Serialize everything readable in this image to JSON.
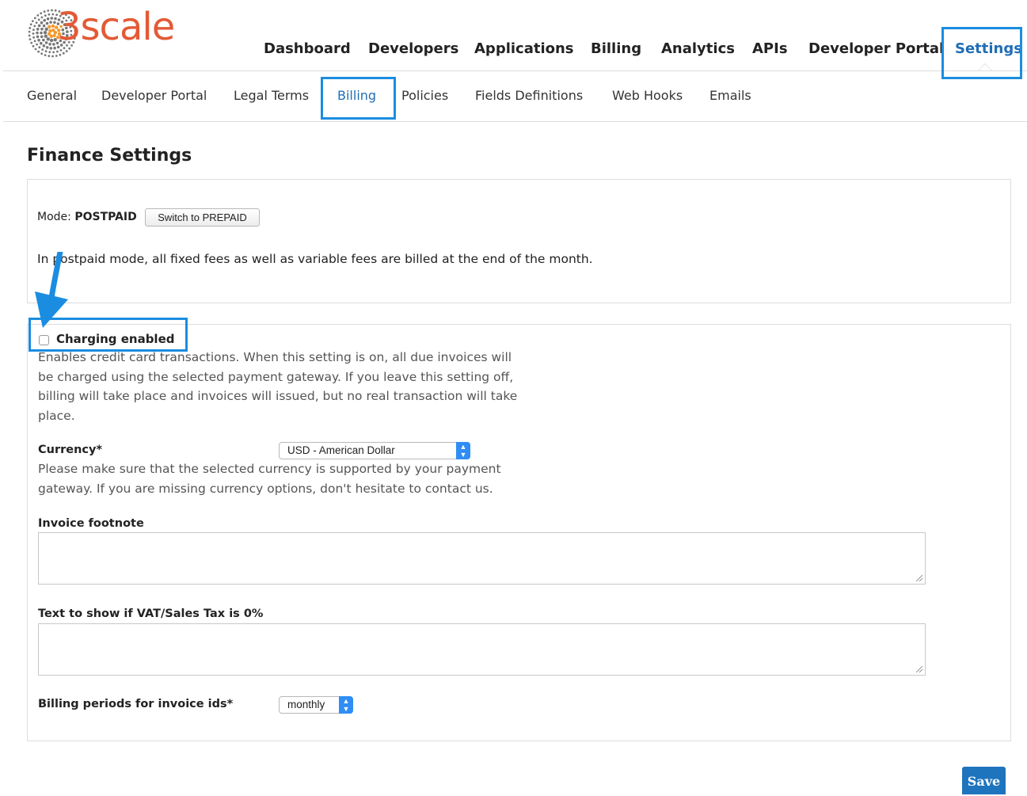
{
  "brand": {
    "name": "3scale",
    "color": "#e35a35"
  },
  "accent_color": "#1b8de0",
  "top_nav": {
    "items": [
      {
        "id": "dashboard",
        "label": "Dashboard"
      },
      {
        "id": "developers",
        "label": "Developers"
      },
      {
        "id": "applications",
        "label": "Applications"
      },
      {
        "id": "billing",
        "label": "Billing"
      },
      {
        "id": "analytics",
        "label": "Analytics"
      },
      {
        "id": "apis",
        "label": "APIs"
      },
      {
        "id": "developer-portal",
        "label": "Developer Portal"
      },
      {
        "id": "settings",
        "label": "Settings"
      }
    ],
    "active": "Settings"
  },
  "sub_nav": {
    "items": [
      {
        "id": "general",
        "label": "General"
      },
      {
        "id": "developer-portal",
        "label": "Developer Portal"
      },
      {
        "id": "legal-terms",
        "label": "Legal Terms"
      },
      {
        "id": "billing",
        "label": "Billing"
      },
      {
        "id": "policies",
        "label": "Policies"
      },
      {
        "id": "fields-definitions",
        "label": "Fields Definitions"
      },
      {
        "id": "web-hooks",
        "label": "Web Hooks"
      },
      {
        "id": "emails",
        "label": "Emails"
      }
    ],
    "active": "Billing"
  },
  "page": {
    "title": "Finance Settings"
  },
  "mode_panel": {
    "mode_label": "Mode:",
    "mode_value": "POSTPAID",
    "switch_button": "Switch to PREPAID",
    "description": "In postpaid mode, all fixed fees as well as variable fees are billed at the end of the month."
  },
  "form": {
    "charging": {
      "label": "Charging enabled",
      "checked": false,
      "help": "Enables credit card transactions. When this setting is on, all due invoices will be charged using the selected payment gateway. If you leave this setting off, billing will take place and invoices will issued, but no real transaction will take place."
    },
    "currency": {
      "label": "Currency*",
      "value": "USD - American Dollar",
      "help": "Please make sure that the selected currency is supported by your payment gateway. If you are missing currency options, don't hesitate to contact us."
    },
    "invoice_footnote": {
      "label": "Invoice footnote",
      "value": ""
    },
    "vat_text": {
      "label": "Text to show if VAT/Sales Tax is 0%",
      "value": ""
    },
    "billing_periods": {
      "label": "Billing periods for invoice ids*",
      "value": "monthly"
    }
  },
  "save_label": "Save"
}
